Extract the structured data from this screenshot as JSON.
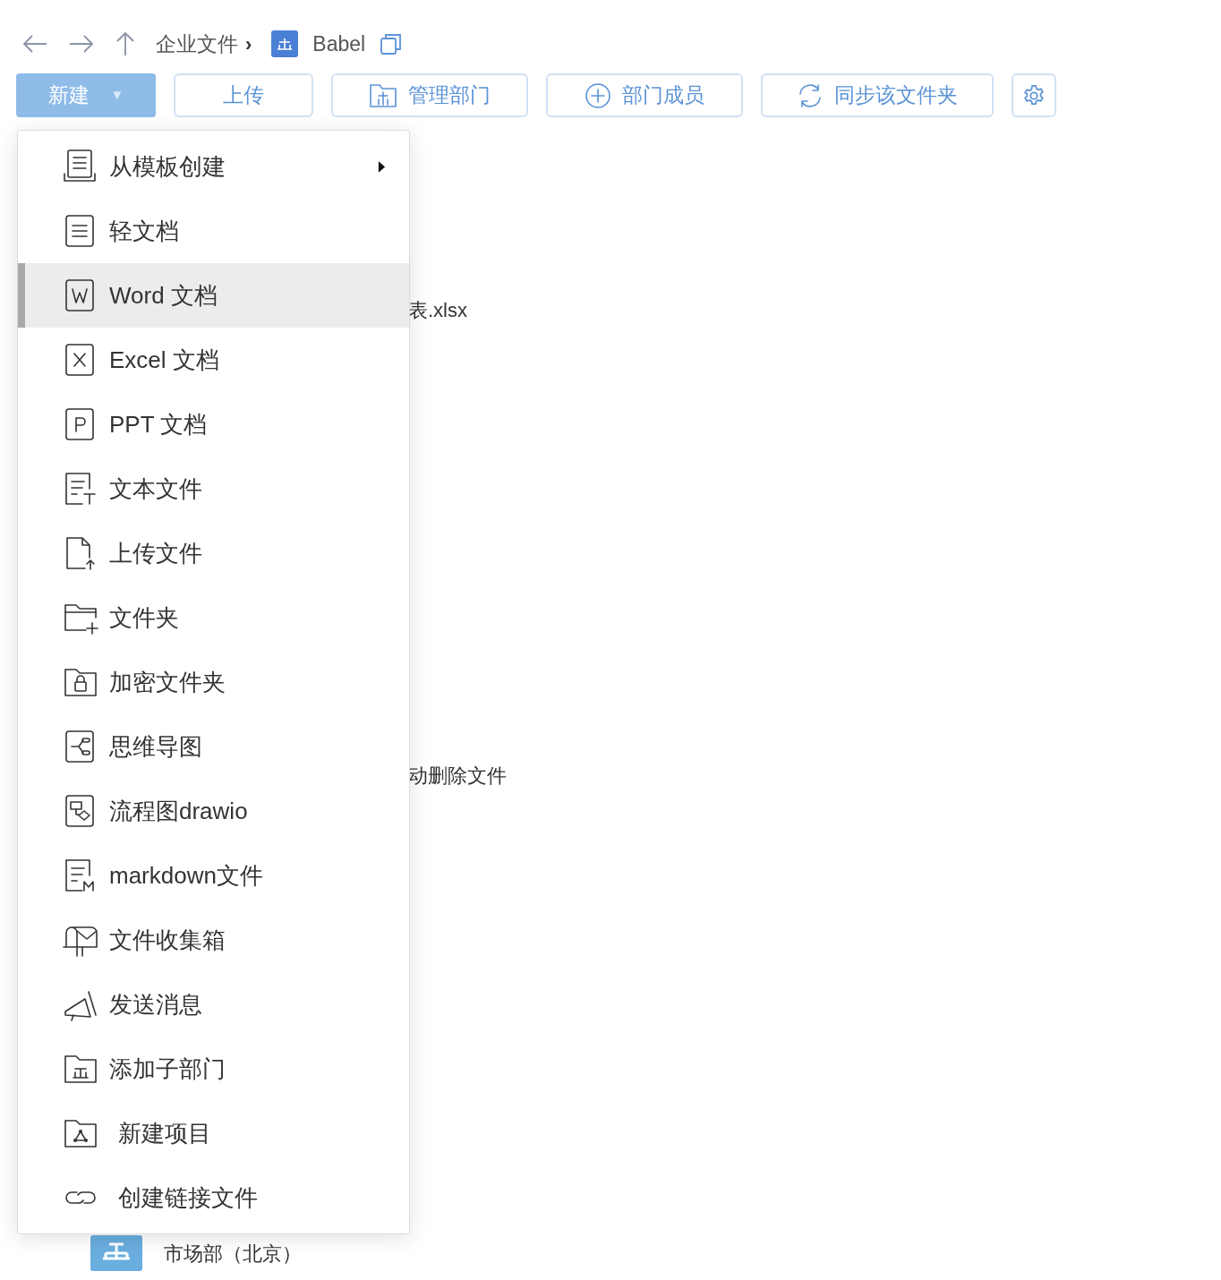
{
  "breadcrumb": {
    "items": [
      "企业文件"
    ],
    "separator": "›",
    "current": "Babel"
  },
  "toolbar": [
    {
      "kind": "new",
      "label": "新建",
      "caret": "▼"
    },
    {
      "kind": "plain",
      "label": "上传"
    },
    {
      "kind": "manage",
      "label": "管理部门"
    },
    {
      "kind": "members",
      "label": "部门成员"
    },
    {
      "kind": "sync",
      "label": "同步该文件夹"
    },
    {
      "kind": "settings"
    }
  ],
  "background_files": [
    {
      "name": "表.xlsx"
    },
    {
      "name": "动删除文件"
    }
  ],
  "background_department": {
    "name": "市场部（北京）"
  },
  "new_menu": {
    "items": [
      {
        "kind": "template",
        "label": "从模板创建",
        "submenu": true,
        "selected": false
      },
      {
        "kind": "lightdoc",
        "label": "轻文档",
        "submenu": false,
        "selected": false
      },
      {
        "kind": "word",
        "label": "Word 文档",
        "submenu": false,
        "selected": true
      },
      {
        "kind": "excel",
        "label": "Excel 文档",
        "submenu": false,
        "selected": false
      },
      {
        "kind": "ppt",
        "label": "PPT 文档",
        "submenu": false,
        "selected": false
      },
      {
        "kind": "text",
        "label": "文本文件",
        "submenu": false,
        "selected": false
      },
      {
        "kind": "upload",
        "label": "上传文件",
        "submenu": false,
        "selected": false
      },
      {
        "kind": "folder",
        "label": "文件夹",
        "submenu": false,
        "selected": false
      },
      {
        "kind": "lockfolder",
        "label": "加密文件夹",
        "submenu": false,
        "selected": false
      },
      {
        "kind": "mindmap",
        "label": "思维导图",
        "submenu": false,
        "selected": false
      },
      {
        "kind": "flow",
        "label": "流程图drawio",
        "submenu": false,
        "selected": false
      },
      {
        "kind": "markdown",
        "label": "markdown文件",
        "submenu": false,
        "selected": false
      },
      {
        "kind": "mailbox",
        "label": "文件收集箱",
        "submenu": false,
        "selected": false
      },
      {
        "kind": "message",
        "label": "发送消息",
        "submenu": false,
        "selected": false
      },
      {
        "kind": "subdept",
        "label": "添加子部门",
        "submenu": false,
        "selected": false
      },
      {
        "kind": "project",
        "label": "新建项目",
        "submenu": false,
        "selected": false
      },
      {
        "kind": "link",
        "label": "创建链接文件",
        "submenu": false,
        "selected": false
      }
    ]
  }
}
